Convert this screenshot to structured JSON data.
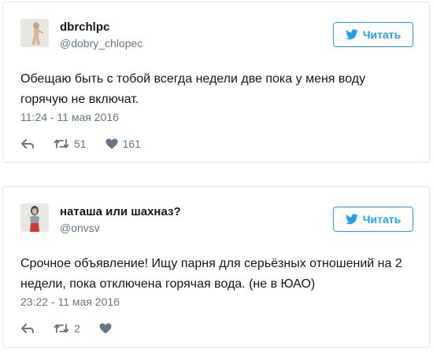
{
  "tweets": [
    {
      "name": "dbrchlpc",
      "handle": "@dobry_chlopec",
      "follow_label": "Читать",
      "text": "Обещаю быть с тобой всегда недели две пока у меня воду горячую не включат.",
      "date": "11:24 - 11 мая 2016",
      "retweets": "51",
      "likes": "161"
    },
    {
      "name": "наташа или шахназ?",
      "handle": "@onvsv",
      "follow_label": "Читать",
      "text": "Срочное объявление! Ищу парня для серьёзных отношений на 2 недели, пока отключена горячая вода. (не в ЮАО)",
      "date": "23:22 - 11 мая 2016",
      "retweets": "2",
      "likes": ""
    }
  ],
  "icons": {
    "follow": "twitter-bird-icon",
    "reply": "reply-icon",
    "retweet": "retweet-icon",
    "like": "heart-icon"
  },
  "colors": {
    "accent": "#1da1f2",
    "text": "#14171a",
    "muted": "#657786",
    "border": "#e1e8ed"
  }
}
